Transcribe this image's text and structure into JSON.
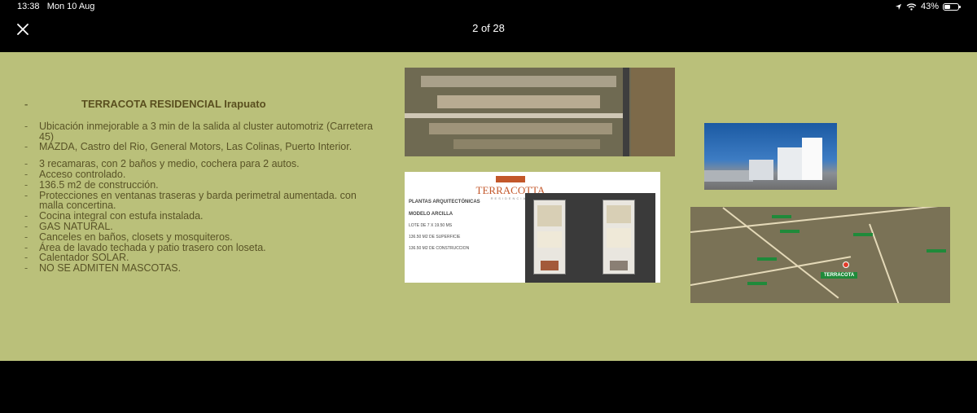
{
  "status_bar": {
    "time": "13:38",
    "date": "Mon 10 Aug",
    "battery_percent": "43%",
    "battery_level": 0.43
  },
  "viewer": {
    "page_counter": "2 of 28",
    "close_icon": "close-icon"
  },
  "slide": {
    "title": "TERRACOTA RESIDENCIAL Irapuato",
    "bullets": [
      "Ubicación inmejorable a 3 min de la salida al cluster automotriz (Carretera 45)",
      "MAZDA, Castro del Rio, General Motors, Las Colinas, Puerto Interior.",
      "3 recamaras, con 2 baños y medio, cochera para 2 autos.",
      "Acceso controlado.",
      "136.5 m2 de construcción.",
      "Protecciones en ventanas traseras y barda perimetral aumentada. con malla concertina.",
      "Cocina integral con estufa instalada.",
      "GAS NATURAL.",
      "Canceles en baños, closets y mosquiteros.",
      "Área de lavado techada y patio trasero con loseta.",
      "Calentador SOLAR.",
      "NO SE ADMITEN MASCOTAS."
    ],
    "plan": {
      "logo": "TERRACOTTA",
      "logo_sub": "RESIDENCIAL",
      "heading": "PLANTAS ARQUITECTÓNICAS",
      "model": "MODELO ARCILLA",
      "lot": "LOTE DE 7 X 19.50 MS",
      "surface": "136.50 M2 DE SUPERFICIE",
      "construction": "136.50 M2 DE CONSTRUCCION"
    },
    "map": {
      "marker_label": "TERRACOTA"
    }
  },
  "colors": {
    "slide_background": "#bac07a",
    "text": "#595326",
    "logo_accent": "#c3572a"
  }
}
